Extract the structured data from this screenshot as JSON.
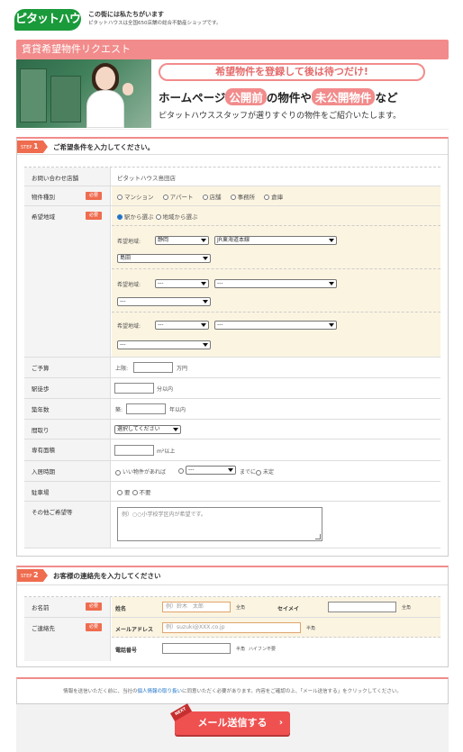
{
  "header": {
    "logo_text": "ピタットハウス",
    "tagline": "この街には私たちがいます",
    "tagline_sub": "ピタットハウスは全国650店舗の総合不動産ショップです。"
  },
  "title": "賃貸希望物件リクエスト",
  "banner": {
    "pill": "希望物件を登録して後は待つだけ!",
    "line2_a": "ホームページ",
    "line2_h1": "公開前",
    "line2_b": "の物件や",
    "line2_h2": "未公開物件",
    "line2_c": "など",
    "line3": "ピタットハウススタッフが選りすぐりの物件をご紹介いたします。"
  },
  "step1": {
    "badge_prefix": "STEP",
    "badge_num": "1",
    "title": "ご希望条件を入力してください。",
    "required": "必要",
    "store": {
      "label": "お問い合わせ店舗",
      "value": "ピタットハウス島田店"
    },
    "type": {
      "label": "物件種別",
      "options": [
        "マンション",
        "アパート",
        "店舗",
        "事務所",
        "倉庫"
      ]
    },
    "area": {
      "label": "希望地域",
      "mode_options": [
        "駅から選ぶ",
        "地域から選ぶ"
      ],
      "group_label": "希望地域:",
      "g1_pref": "静岡",
      "g1_line": "JR東海道本線",
      "g1_station": "島田",
      "dash": "---"
    },
    "budget": {
      "label": "ご予算",
      "prefix": "上限:",
      "unit": "万円"
    },
    "walk": {
      "label": "駅徒歩",
      "unit": "分以内"
    },
    "age": {
      "label": "築年数",
      "prefix": "築:",
      "unit": "年以内"
    },
    "layout": {
      "label": "間取り",
      "value": "選択してください"
    },
    "size": {
      "label": "専有面積",
      "unit": "m²以上"
    },
    "move": {
      "label": "入居時期",
      "opt1": "いい物件があれば",
      "sel": "---",
      "until": "までに",
      "opt2": "未定"
    },
    "parking": {
      "label": "駐車場",
      "options": [
        "要",
        "不要"
      ]
    },
    "other": {
      "label": "その他ご希望等",
      "placeholder": "例）○○小学校学区内が希望です。"
    }
  },
  "step2": {
    "badge_prefix": "STEP",
    "badge_num": "2",
    "title": "お客様の連絡先を入力してください",
    "required": "必要",
    "name": {
      "label": "お名前",
      "sei_label": "姓名",
      "sei_placeholder": "例）鈴木　太郎",
      "fullwidth": "全角",
      "kana_label": "セイメイ",
      "kana_fullwidth": "全角"
    },
    "contact": {
      "label": "ご連絡先",
      "mail_label": "メールアドレス",
      "mail_placeholder": "例）suzuki@XXX.co.jp",
      "halfwidth": "半角",
      "tel_label": "電話番号",
      "tel_halfwidth": "半角",
      "tel_note": "ハイフン不要"
    }
  },
  "notice": {
    "before": "情報を送信いただく前に、当社の",
    "link": "個人情報の取り扱い",
    "after": "に同意いただく必要があります。内容をご確認の上、「メール送信する」をクリックしてください。"
  },
  "submit": {
    "label": "メール送信する",
    "ribbon": "NEXT",
    "arrow": "›"
  },
  "colors": {
    "accent": "#f28b8b",
    "badge": "#ef6c4f",
    "submit": "#ef5151",
    "brand": "#1a9a3a"
  }
}
